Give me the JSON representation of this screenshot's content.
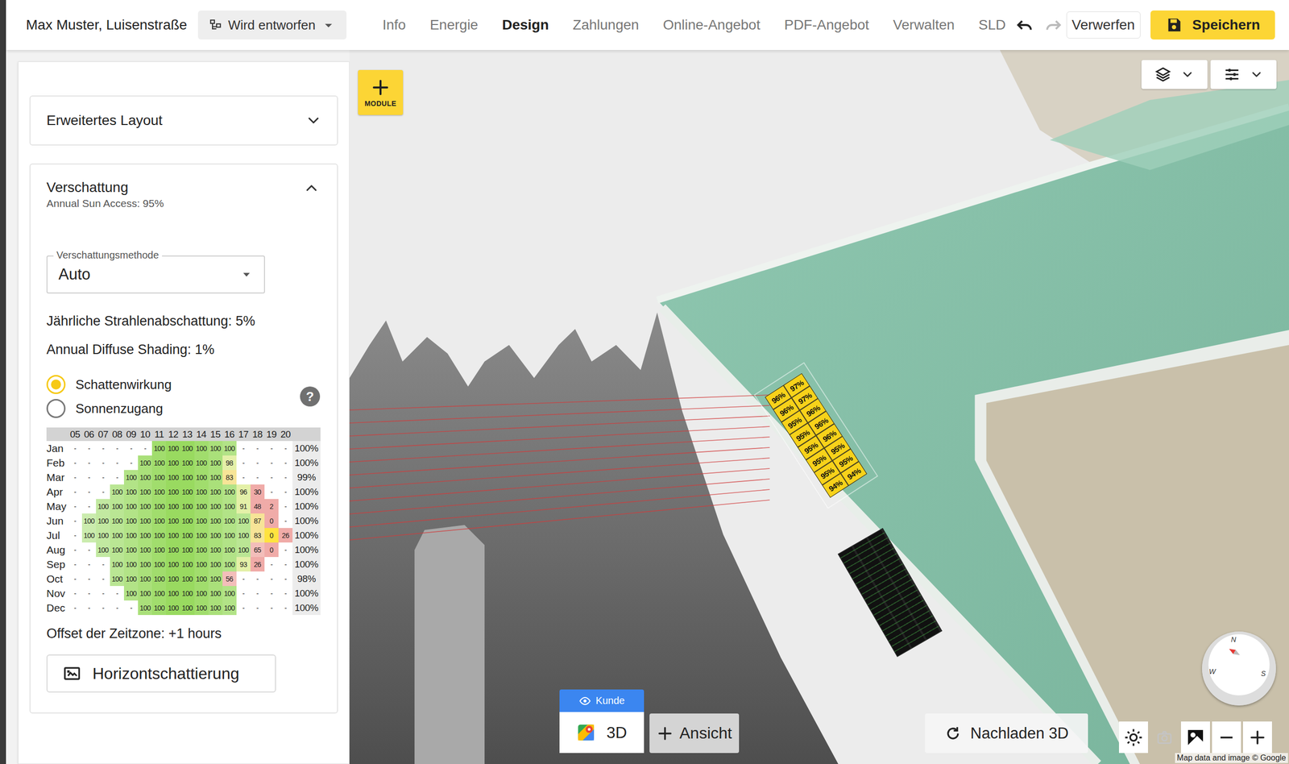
{
  "header": {
    "project": "Max Muster, Luisenstraße",
    "status": "Wird entworfen",
    "tabs": [
      {
        "label": "Info",
        "selected": false
      },
      {
        "label": "Energie",
        "selected": false
      },
      {
        "label": "Design",
        "selected": true
      },
      {
        "label": "Zahlungen",
        "selected": false
      },
      {
        "label": "Online-Angebot",
        "selected": false
      },
      {
        "label": "PDF-Angebot",
        "selected": false
      },
      {
        "label": "Verwalten",
        "selected": false
      },
      {
        "label": "SLD",
        "selected": false
      }
    ],
    "undo_disabled": false,
    "redo_disabled": true,
    "discard": "Verwerfen",
    "save": "Speichern"
  },
  "sidebar": {
    "layout_card": {
      "title": "Erweitertes Layout",
      "expanded": false
    },
    "shading_card": {
      "title": "Verschattung",
      "subtitle": "Annual Sun Access: 95%",
      "expanded": true,
      "method_label": "Verschattungsmethode",
      "method_value": "Auto",
      "annual_beam": "Jährliche Strahlenabschattung: 5%",
      "annual_diffuse": "Annual Diffuse Shading: 1%",
      "modes": [
        {
          "label": "Schattenwirkung",
          "selected": true
        },
        {
          "label": "Sonnenzugang",
          "selected": false
        }
      ],
      "help": "?",
      "table": {
        "hours": [
          "05",
          "06",
          "07",
          "08",
          "09",
          "10",
          "11",
          "12",
          "13",
          "14",
          "15",
          "16",
          "17",
          "18",
          "19",
          "20"
        ],
        "highlight": {
          "row": 6,
          "col": 14
        },
        "rows": [
          {
            "month": "Jan",
            "values": [
              "-",
              "-",
              "-",
              "-",
              "-",
              "-",
              "100",
              "100",
              "100",
              "100",
              "100",
              "100",
              "-",
              "-",
              "-",
              "-"
            ],
            "total": "100%"
          },
          {
            "month": "Feb",
            "values": [
              "-",
              "-",
              "-",
              "-",
              "-",
              "100",
              "100",
              "100",
              "100",
              "100",
              "100",
              "98",
              "-",
              "-",
              "-",
              "-"
            ],
            "total": "100%"
          },
          {
            "month": "Mar",
            "values": [
              "-",
              "-",
              "-",
              "-",
              "100",
              "100",
              "100",
              "100",
              "100",
              "100",
              "100",
              "83",
              "-",
              "-",
              "-",
              "-"
            ],
            "total": "99%"
          },
          {
            "month": "Apr",
            "values": [
              "-",
              "-",
              "-",
              "100",
              "100",
              "100",
              "100",
              "100",
              "100",
              "100",
              "100",
              "100",
              "96",
              "30",
              "-",
              "-"
            ],
            "total": "100%"
          },
          {
            "month": "May",
            "values": [
              "-",
              "-",
              "100",
              "100",
              "100",
              "100",
              "100",
              "100",
              "100",
              "100",
              "100",
              "100",
              "91",
              "48",
              "2",
              "-"
            ],
            "total": "100%"
          },
          {
            "month": "Jun",
            "values": [
              "-",
              "100",
              "100",
              "100",
              "100",
              "100",
              "100",
              "100",
              "100",
              "100",
              "100",
              "100",
              "100",
              "87",
              "0",
              "-"
            ],
            "total": "100%"
          },
          {
            "month": "Jul",
            "values": [
              "-",
              "100",
              "100",
              "100",
              "100",
              "100",
              "100",
              "100",
              "100",
              "100",
              "100",
              "100",
              "100",
              "83",
              "0",
              "26"
            ],
            "total": "100%"
          },
          {
            "month": "Aug",
            "values": [
              "-",
              "-",
              "100",
              "100",
              "100",
              "100",
              "100",
              "100",
              "100",
              "100",
              "100",
              "100",
              "100",
              "65",
              "0",
              "-"
            ],
            "total": "100%"
          },
          {
            "month": "Sep",
            "values": [
              "-",
              "-",
              "-",
              "100",
              "100",
              "100",
              "100",
              "100",
              "100",
              "100",
              "100",
              "100",
              "93",
              "26",
              "-",
              "-"
            ],
            "total": "100%"
          },
          {
            "month": "Oct",
            "values": [
              "-",
              "-",
              "-",
              "100",
              "100",
              "100",
              "100",
              "100",
              "100",
              "100",
              "100",
              "56",
              "-",
              "-",
              "-",
              "-"
            ],
            "total": "98%"
          },
          {
            "month": "Nov",
            "values": [
              "-",
              "-",
              "-",
              "-",
              "100",
              "100",
              "100",
              "100",
              "100",
              "100",
              "100",
              "100",
              "-",
              "-",
              "-",
              "-"
            ],
            "total": "100%"
          },
          {
            "month": "Dec",
            "values": [
              "-",
              "-",
              "-",
              "-",
              "-",
              "100",
              "100",
              "100",
              "100",
              "100",
              "100",
              "100",
              "-",
              "-",
              "-",
              "-"
            ],
            "total": "100%"
          }
        ]
      },
      "timezone": "Offset der Zeitzone: +1 hours",
      "horizon_button": "Horizontschattierung"
    }
  },
  "map": {
    "add_module": "MODULE",
    "modules": [
      "96%",
      "97%",
      "96%",
      "97%",
      "95%",
      "96%",
      "95%",
      "96%",
      "95%",
      "96%",
      "95%",
      "95%",
      "95%",
      "95%",
      "94%",
      "94%"
    ],
    "view_tab": "Kunde",
    "view": "3D",
    "add_view": "Ansicht",
    "reload": "Nachladen 3D",
    "camera_disabled": true,
    "compass": [
      "N",
      "W",
      "S"
    ],
    "attribution": "Map data and image © Google"
  }
}
